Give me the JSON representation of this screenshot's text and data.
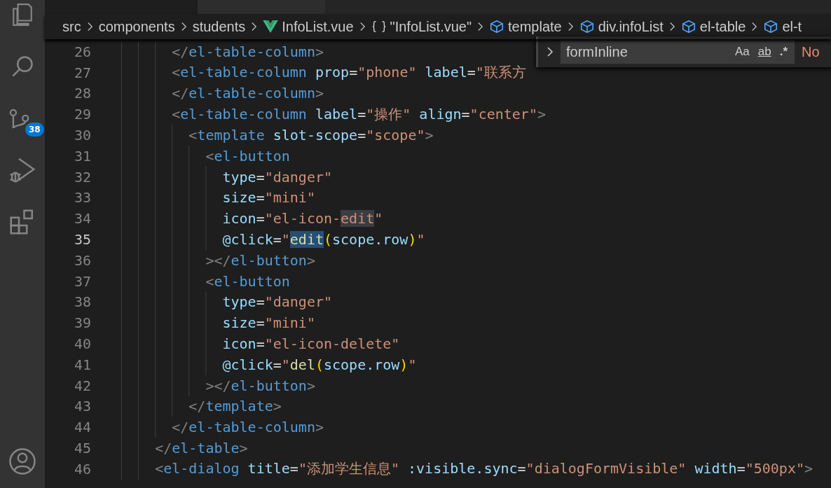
{
  "editor_tabs": [
    {
      "selected": true
    },
    {
      "selected": false
    }
  ],
  "activity_bar": {
    "items": [
      {
        "kind": "explorer",
        "selected": false
      },
      {
        "kind": "search",
        "selected": false
      },
      {
        "kind": "scm",
        "selected": false,
        "badge": "38"
      },
      {
        "kind": "debug",
        "selected": false
      },
      {
        "kind": "extensions",
        "selected": false
      }
    ],
    "account": {
      "kind": "account"
    }
  },
  "breadcrumbs": [
    {
      "kind": "folder",
      "label": "src"
    },
    {
      "kind": "folder",
      "label": "components"
    },
    {
      "kind": "folder",
      "label": "students"
    },
    {
      "kind": "vue",
      "label": "InfoList.vue"
    },
    {
      "kind": "module",
      "label": "\"InfoList.vue\""
    },
    {
      "kind": "element",
      "label": "template"
    },
    {
      "kind": "element",
      "label": "div.infoList"
    },
    {
      "kind": "element",
      "label": "el-table"
    },
    {
      "kind": "element",
      "label": "el-t"
    }
  ],
  "find_widget": {
    "value": "formInline",
    "options": [
      {
        "kind": "case",
        "label": "Aa",
        "on": false
      },
      {
        "kind": "word",
        "label": "ab",
        "on": false
      },
      {
        "kind": "regex",
        "label": ".*",
        "on": false
      }
    ],
    "result": "No"
  },
  "lines": [
    {
      "number": "26",
      "current": false,
      "tokens": [
        {
          "kind": "punct",
          "text": "      </"
        },
        {
          "kind": "tag",
          "text": "el-table-column"
        },
        {
          "kind": "punct",
          "text": ">"
        }
      ]
    },
    {
      "number": "27",
      "current": false,
      "tokens": [
        {
          "kind": "punct",
          "text": "      <"
        },
        {
          "kind": "tag",
          "text": "el-table-column"
        },
        {
          "kind": "attr",
          "text": " prop"
        },
        {
          "kind": "text",
          "text": "="
        },
        {
          "kind": "str",
          "text": "\"phone\""
        },
        {
          "kind": "attr",
          "text": " label"
        },
        {
          "kind": "text",
          "text": "="
        },
        {
          "kind": "str",
          "text": "\"联系方"
        }
      ]
    },
    {
      "number": "28",
      "current": false,
      "tokens": [
        {
          "kind": "punct",
          "text": "      </"
        },
        {
          "kind": "tag",
          "text": "el-table-column"
        },
        {
          "kind": "punct",
          "text": ">"
        }
      ]
    },
    {
      "number": "29",
      "current": false,
      "tokens": [
        {
          "kind": "punct",
          "text": "      <"
        },
        {
          "kind": "tag",
          "text": "el-table-column"
        },
        {
          "kind": "attr",
          "text": " label"
        },
        {
          "kind": "text",
          "text": "="
        },
        {
          "kind": "str",
          "text": "\"操作\""
        },
        {
          "kind": "attr",
          "text": " align"
        },
        {
          "kind": "text",
          "text": "="
        },
        {
          "kind": "str",
          "text": "\"center\""
        },
        {
          "kind": "punct",
          "text": ">"
        }
      ]
    },
    {
      "number": "30",
      "current": false,
      "tokens": [
        {
          "kind": "punct",
          "text": "        <"
        },
        {
          "kind": "tag",
          "text": "template"
        },
        {
          "kind": "attr",
          "text": " slot-scope"
        },
        {
          "kind": "text",
          "text": "="
        },
        {
          "kind": "str",
          "text": "\"scope\""
        },
        {
          "kind": "punct",
          "text": ">"
        }
      ]
    },
    {
      "number": "31",
      "current": false,
      "tokens": [
        {
          "kind": "punct",
          "text": "          <"
        },
        {
          "kind": "tag",
          "text": "el-button"
        }
      ]
    },
    {
      "number": "32",
      "current": false,
      "tokens": [
        {
          "kind": "attr",
          "text": "            type"
        },
        {
          "kind": "text",
          "text": "="
        },
        {
          "kind": "str",
          "text": "\"danger\""
        }
      ]
    },
    {
      "number": "33",
      "current": false,
      "tokens": [
        {
          "kind": "attr",
          "text": "            size"
        },
        {
          "kind": "text",
          "text": "="
        },
        {
          "kind": "str",
          "text": "\"mini\""
        }
      ]
    },
    {
      "number": "34",
      "current": false,
      "tokens": [
        {
          "kind": "attr",
          "text": "            icon"
        },
        {
          "kind": "text",
          "text": "="
        },
        {
          "kind": "str",
          "text": "\"el-icon-"
        },
        {
          "kind": "str",
          "text": "edit",
          "match": true
        },
        {
          "kind": "str",
          "text": "\""
        }
      ]
    },
    {
      "number": "35",
      "current": true,
      "tokens": [
        {
          "kind": "attr",
          "text": "            @click"
        },
        {
          "kind": "text",
          "text": "="
        },
        {
          "kind": "str",
          "text": "\""
        },
        {
          "kind": "fn",
          "text": "edit",
          "selected": true
        },
        {
          "kind": "bracket",
          "text": "("
        },
        {
          "kind": "var",
          "text": "scope.row"
        },
        {
          "kind": "bracket",
          "text": ")"
        },
        {
          "kind": "str",
          "text": "\""
        }
      ]
    },
    {
      "number": "36",
      "current": false,
      "tokens": [
        {
          "kind": "punct",
          "text": "          ></"
        },
        {
          "kind": "tag",
          "text": "el-button"
        },
        {
          "kind": "punct",
          "text": ">"
        }
      ]
    },
    {
      "number": "37",
      "current": false,
      "tokens": [
        {
          "kind": "punct",
          "text": "          <"
        },
        {
          "kind": "tag",
          "text": "el-button"
        }
      ]
    },
    {
      "number": "38",
      "current": false,
      "tokens": [
        {
          "kind": "attr",
          "text": "            type"
        },
        {
          "kind": "text",
          "text": "="
        },
        {
          "kind": "str",
          "text": "\"danger\""
        }
      ]
    },
    {
      "number": "39",
      "current": false,
      "tokens": [
        {
          "kind": "attr",
          "text": "            size"
        },
        {
          "kind": "text",
          "text": "="
        },
        {
          "kind": "str",
          "text": "\"mini\""
        }
      ]
    },
    {
      "number": "40",
      "current": false,
      "tokens": [
        {
          "kind": "attr",
          "text": "            icon"
        },
        {
          "kind": "text",
          "text": "="
        },
        {
          "kind": "str",
          "text": "\"el-icon-delete\""
        }
      ]
    },
    {
      "number": "41",
      "current": false,
      "tokens": [
        {
          "kind": "attr",
          "text": "            @click"
        },
        {
          "kind": "text",
          "text": "="
        },
        {
          "kind": "str",
          "text": "\""
        },
        {
          "kind": "fn",
          "text": "del"
        },
        {
          "kind": "bracket",
          "text": "("
        },
        {
          "kind": "var",
          "text": "scope.row"
        },
        {
          "kind": "bracket",
          "text": ")"
        },
        {
          "kind": "str",
          "text": "\""
        }
      ]
    },
    {
      "number": "42",
      "current": false,
      "tokens": [
        {
          "kind": "punct",
          "text": "          ></"
        },
        {
          "kind": "tag",
          "text": "el-button"
        },
        {
          "kind": "punct",
          "text": ">"
        }
      ]
    },
    {
      "number": "43",
      "current": false,
      "tokens": [
        {
          "kind": "punct",
          "text": "        </"
        },
        {
          "kind": "tag",
          "text": "template"
        },
        {
          "kind": "punct",
          "text": ">"
        }
      ]
    },
    {
      "number": "44",
      "current": false,
      "tokens": [
        {
          "kind": "punct",
          "text": "      </"
        },
        {
          "kind": "tag",
          "text": "el-table-column"
        },
        {
          "kind": "punct",
          "text": ">"
        }
      ]
    },
    {
      "number": "45",
      "current": false,
      "tokens": [
        {
          "kind": "punct",
          "text": "    </"
        },
        {
          "kind": "tag",
          "text": "el-table"
        },
        {
          "kind": "punct",
          "text": ">"
        }
      ]
    },
    {
      "number": "46",
      "current": false,
      "tokens": [
        {
          "kind": "punct",
          "text": "    <"
        },
        {
          "kind": "tag",
          "text": "el-dialog"
        },
        {
          "kind": "attr",
          "text": " title"
        },
        {
          "kind": "text",
          "text": "="
        },
        {
          "kind": "str",
          "text": "\"添加学生信息\""
        },
        {
          "kind": "attr",
          "text": " :visible.sync"
        },
        {
          "kind": "text",
          "text": "="
        },
        {
          "kind": "str",
          "text": "\"dialogFormVisible\""
        },
        {
          "kind": "attr",
          "text": " width"
        },
        {
          "kind": "text",
          "text": "="
        },
        {
          "kind": "str",
          "text": "\"500px\""
        },
        {
          "kind": "punct",
          "text": ">"
        }
      ]
    }
  ]
}
